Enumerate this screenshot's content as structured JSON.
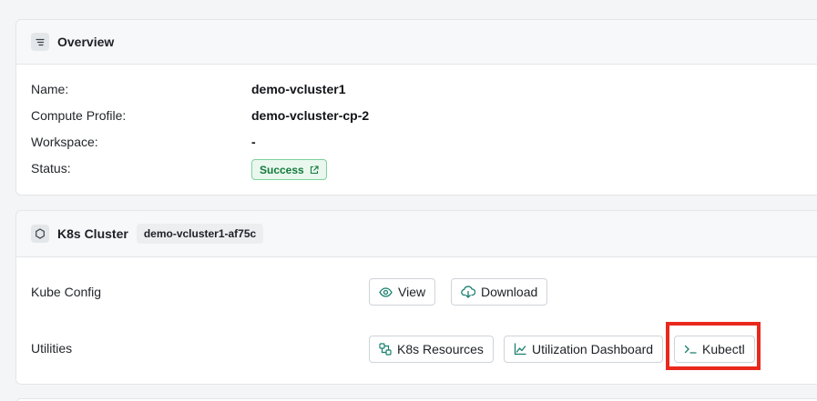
{
  "overview": {
    "title": "Overview",
    "icon": "list-icon",
    "fields": [
      {
        "label": "Name:",
        "value": "demo-vcluster1"
      },
      {
        "label": "Compute Profile:",
        "value": "demo-vcluster-cp-2"
      },
      {
        "label": "Workspace:",
        "value": "-"
      }
    ],
    "status": {
      "label": "Status:",
      "value": "Success",
      "icon": "external-link-icon"
    }
  },
  "k8s_cluster": {
    "title": "K8s Cluster",
    "icon": "hexagon-icon",
    "cluster_id": "demo-vcluster1-af75c",
    "kube_config": {
      "label": "Kube Config",
      "view_label": "View",
      "download_label": "Download"
    },
    "utilities": {
      "label": "Utilities",
      "k8s_resources_label": "K8s Resources",
      "utilization_dashboard_label": "Utilization Dashboard",
      "kubectl_label": "Kubectl"
    }
  },
  "colors": {
    "accent": "#1a7f6e",
    "success_bg": "#e9f7ee",
    "success_border": "#7fd19b",
    "success_text": "#137a3a",
    "highlight": "#e8291c"
  }
}
